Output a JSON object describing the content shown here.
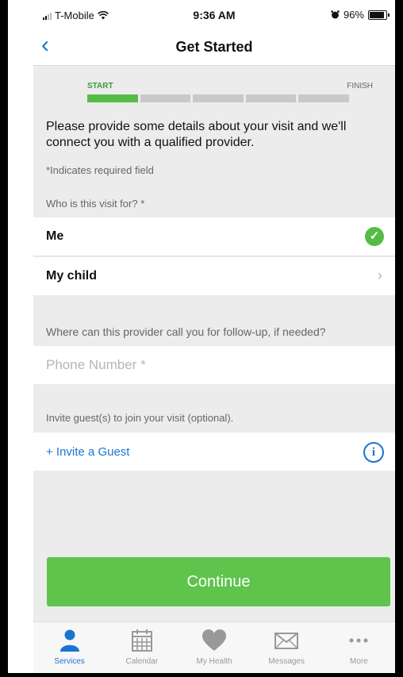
{
  "status_bar": {
    "carrier": "T-Mobile",
    "time": "9:36 AM",
    "battery": "96%"
  },
  "nav": {
    "title": "Get Started"
  },
  "progress": {
    "start_label": "START",
    "finish_label": "FINISH",
    "total_steps": 5,
    "completed_steps": 1
  },
  "intro": "Please provide some details about your visit and we'll connect you with a qualified provider.",
  "required_note": "*Indicates required field",
  "who_label": "Who is this visit for? *",
  "options": {
    "me": "Me",
    "child": "My child"
  },
  "followup_label": "Where can this provider call you for follow-up, if needed?",
  "phone": {
    "placeholder": "Phone Number *",
    "value": ""
  },
  "invite": {
    "label": "Invite guest(s) to join your visit (optional).",
    "link": "+ Invite a Guest"
  },
  "continue_label": "Continue",
  "tabs": [
    {
      "label": "Services",
      "icon": "person-icon",
      "active": true
    },
    {
      "label": "Calendar",
      "icon": "calendar-icon",
      "active": false
    },
    {
      "label": "My Health",
      "icon": "heart-icon",
      "active": false
    },
    {
      "label": "Messages",
      "icon": "envelope-icon",
      "active": false
    },
    {
      "label": "More",
      "icon": "more-icon",
      "active": false
    }
  ],
  "colors": {
    "accent": "#1a75d1",
    "success": "#55bd46",
    "button": "#5ec44c"
  }
}
